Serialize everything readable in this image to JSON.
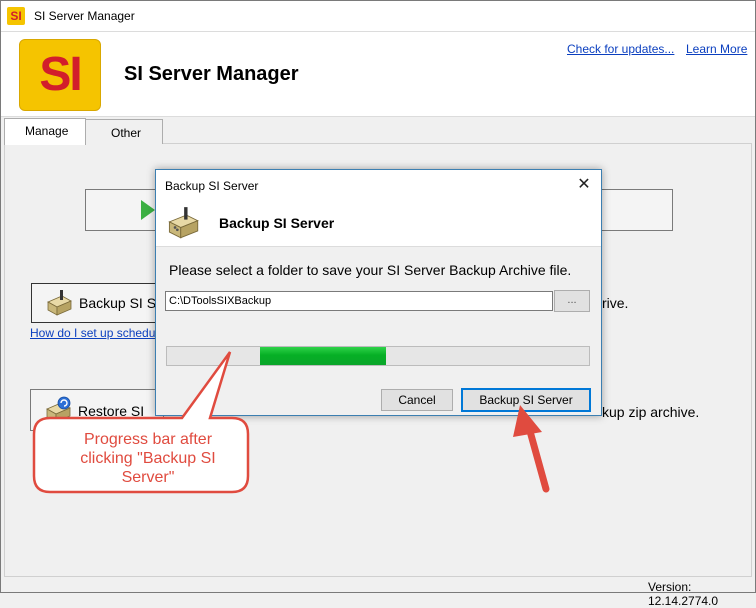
{
  "window": {
    "title": "SI Server Manager",
    "app_icon_text": "SI"
  },
  "header": {
    "logo_text": "SI",
    "app_name": "SI Server Manager",
    "links": {
      "check_updates": "Check for updates...",
      "learn_more": "Learn More"
    }
  },
  "tabs": [
    {
      "label": "Manage",
      "selected": true
    },
    {
      "label": "Other",
      "selected": false
    }
  ],
  "manage": {
    "backup_button_label": "Backup SI Se",
    "backup_help_link": "How do I set up scheduled",
    "backup_description_tail": "rive.",
    "restore_button_label": "Restore SI Se",
    "restore_description_tail": "kup zip archive."
  },
  "status_bar": {
    "version": "Version: 12.14.2774.0"
  },
  "dialog": {
    "title": "Backup SI Server",
    "close_glyph": "✕",
    "heading": "Backup SI Server",
    "prompt": "Please select a folder to save your SI Server Backup Archive file.",
    "path_value": "C:\\DToolsSIXBackup",
    "browse_label": "...",
    "progress": {
      "start": 0.22,
      "end": 0.52
    },
    "cancel_label": "Cancel",
    "backup_label": "Backup SI Server"
  },
  "annotation": {
    "text": "Progress bar after clicking \"Backup SI Server\"",
    "color": "#e04b3f"
  },
  "colors": {
    "accent": "#0078d7",
    "progress_green": "#06b025",
    "logo_yellow": "#f5c400",
    "logo_red": "#d21e2b"
  },
  "icons": [
    "backup-drive-icon",
    "restore-drive-icon",
    "play-icon",
    "close-icon"
  ]
}
